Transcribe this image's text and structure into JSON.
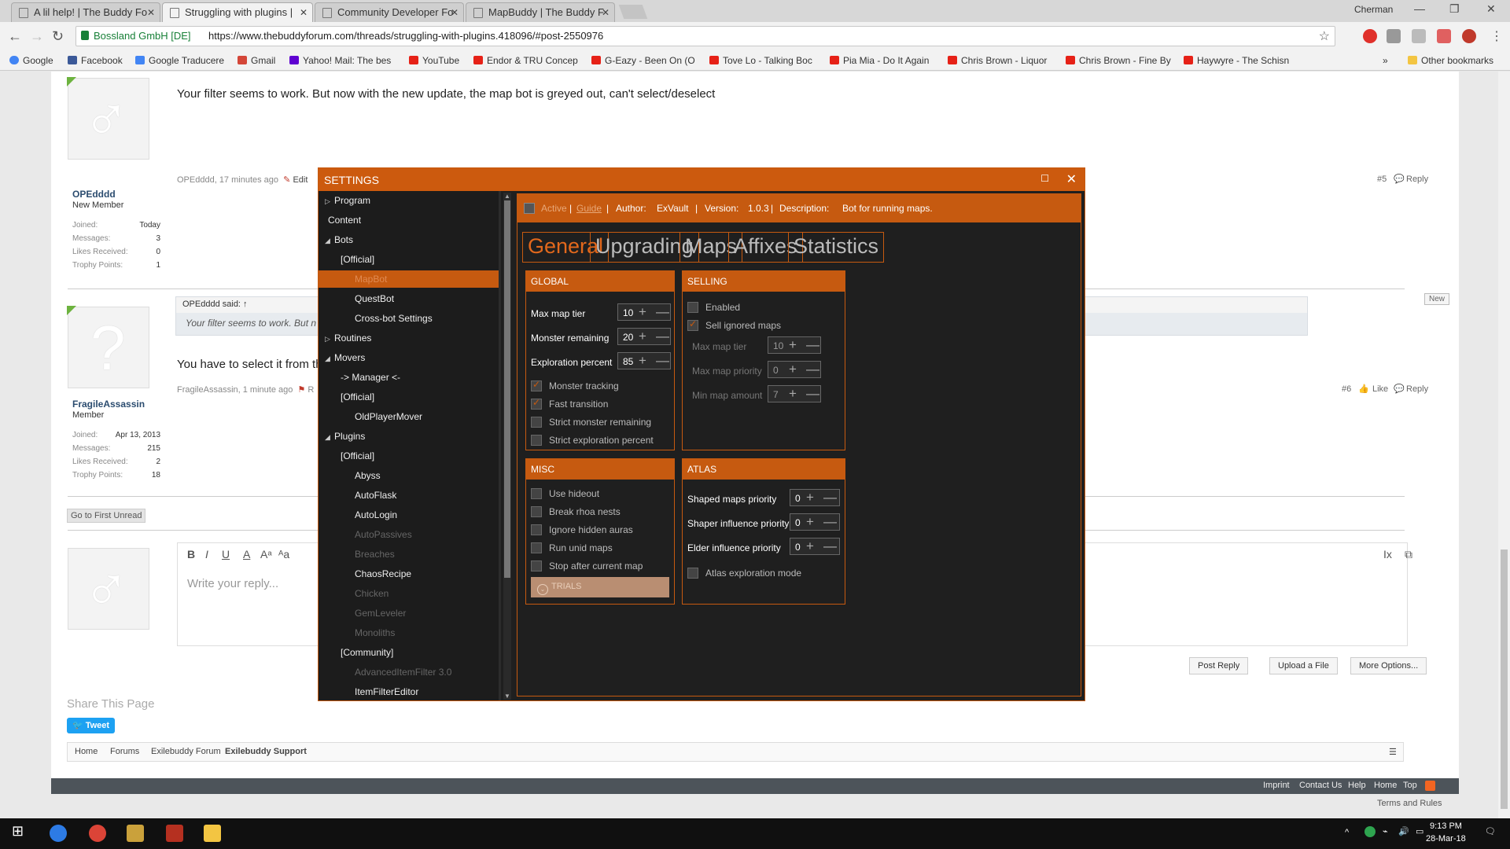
{
  "browser": {
    "tabs": [
      {
        "title": "A lil help! | The Buddy Fo"
      },
      {
        "title": "Struggling with plugins | "
      },
      {
        "title": "Community Developer Fo"
      },
      {
        "title": "MapBuddy | The Buddy F"
      }
    ],
    "user": "Cherman",
    "secure_label": "Bossland GmbH [DE]",
    "url": "https://www.thebuddyforum.com/threads/struggling-with-plugins.418096/#post-2550976",
    "bookmarks": [
      "Google",
      "Facebook",
      "Google Traducere",
      "Gmail",
      "Yahoo! Mail: The bes",
      "YouTube",
      "Endor & TRU Concep",
      "G-Eazy - Been On (O",
      "Tove Lo - Talking Boc",
      "Pia Mia - Do It Again",
      "Chris Brown - Liquor",
      "Chris Brown - Fine By",
      "Haywyre - The Schisn"
    ],
    "other_bookmarks": "Other bookmarks",
    "bookmark_more": "»"
  },
  "post1": {
    "text": "Your filter seems to work. But now with the new update, the map bot is greyed out, can't select/deselect",
    "username": "OPEdddd",
    "role": "New Member",
    "stats": [
      [
        "Joined:",
        "Today"
      ],
      [
        "Messages:",
        "3"
      ],
      [
        "Likes Received:",
        "0"
      ],
      [
        "Trophy Points:",
        "1"
      ]
    ],
    "meta": "OPEdddd, 17 minutes ago",
    "edit": "Edit",
    "num": "#5",
    "reply": "Reply"
  },
  "post2": {
    "quote_header": "OPEdddd said: ↑",
    "quote_body": "Your filter seems to work. But n",
    "text": "You have to select it from th",
    "username": "FragileAssassin",
    "role": "Member",
    "stats": [
      [
        "Joined:",
        "Apr 13, 2013"
      ],
      [
        "Messages:",
        "215"
      ],
      [
        "Likes Received:",
        "2"
      ],
      [
        "Trophy Points:",
        "18"
      ]
    ],
    "meta": "FragileAssassin, 1 minute ago",
    "meta_extra": "R",
    "num": "#6",
    "like": "Like",
    "reply": "Reply",
    "new_badge": "New"
  },
  "forum": {
    "go_first_unread": "Go to First Unread",
    "reply_placeholder": "Write your reply...",
    "post_reply": "Post Reply",
    "upload": "Upload a File",
    "more_options": "More Options...",
    "share_title": "Share This Page",
    "tweet": "Tweet",
    "breadcrumbs": [
      "Home",
      "Forums",
      "Exilebuddy Forum",
      "Exilebuddy Support"
    ],
    "footer_links": [
      "Imprint",
      "Contact Us",
      "Help",
      "Home",
      "Top"
    ],
    "terms": "Terms and Rules"
  },
  "settings": {
    "title": "SETTINGS",
    "tree": [
      {
        "label": "Program",
        "level": 0,
        "arrow": "▷",
        "dim": false
      },
      {
        "label": "Content",
        "level": 0,
        "arrow": "",
        "dim": false
      },
      {
        "label": "Bots",
        "level": 0,
        "arrow": "◢",
        "dim": false
      },
      {
        "label": "[Official]",
        "level": 1,
        "arrow": "",
        "dim": false
      },
      {
        "label": "MapBot",
        "level": 2,
        "arrow": "",
        "dim": false,
        "selected": true
      },
      {
        "label": "QuestBot",
        "level": 2,
        "arrow": "",
        "dim": false
      },
      {
        "label": "Cross-bot Settings",
        "level": 2,
        "arrow": "",
        "dim": false
      },
      {
        "label": "Routines",
        "level": 0,
        "arrow": "▷",
        "dim": false
      },
      {
        "label": "Movers",
        "level": 0,
        "arrow": "◢",
        "dim": false
      },
      {
        "label": "-> Manager <-",
        "level": 1,
        "arrow": "",
        "dim": false
      },
      {
        "label": "[Official]",
        "level": 1,
        "arrow": "",
        "dim": false
      },
      {
        "label": "OldPlayerMover",
        "level": 2,
        "arrow": "",
        "dim": false
      },
      {
        "label": "Plugins",
        "level": 0,
        "arrow": "◢",
        "dim": false
      },
      {
        "label": "[Official]",
        "level": 1,
        "arrow": "",
        "dim": false
      },
      {
        "label": "Abyss",
        "level": 2,
        "arrow": "",
        "dim": false
      },
      {
        "label": "AutoFlask",
        "level": 2,
        "arrow": "",
        "dim": false
      },
      {
        "label": "AutoLogin",
        "level": 2,
        "arrow": "",
        "dim": false
      },
      {
        "label": "AutoPassives",
        "level": 2,
        "arrow": "",
        "dim": true
      },
      {
        "label": "Breaches",
        "level": 2,
        "arrow": "",
        "dim": true
      },
      {
        "label": "ChaosRecipe",
        "level": 2,
        "arrow": "",
        "dim": false
      },
      {
        "label": "Chicken",
        "level": 2,
        "arrow": "",
        "dim": true
      },
      {
        "label": "GemLeveler",
        "level": 2,
        "arrow": "",
        "dim": true
      },
      {
        "label": "Monoliths",
        "level": 2,
        "arrow": "",
        "dim": true
      },
      {
        "label": "[Community]",
        "level": 1,
        "arrow": "",
        "dim": false
      },
      {
        "label": "AdvancedItemFilter 3.0",
        "level": 2,
        "arrow": "",
        "dim": true
      },
      {
        "label": "ItemFilterEditor",
        "level": 2,
        "arrow": "",
        "dim": false
      }
    ],
    "info": {
      "active": "Active",
      "guide": "Guide",
      "author_label": "Author:",
      "author": "ExVault",
      "version_label": "Version:",
      "version": "1.0.3",
      "desc_label": "Description:",
      "desc": "Bot for running maps.",
      "sep": "|"
    },
    "tabs": [
      "General",
      "Upgrading",
      "Maps",
      "Affixes",
      "Statistics"
    ],
    "global": {
      "title": "GLOBAL",
      "fields": [
        {
          "label": "Max map tier",
          "value": "10"
        },
        {
          "label": "Monster remaining",
          "value": "20"
        },
        {
          "label": "Exploration percent",
          "value": "85"
        }
      ],
      "checks": [
        {
          "label": "Monster tracking",
          "on": true
        },
        {
          "label": "Fast transition",
          "on": true
        },
        {
          "label": "Strict monster remaining",
          "on": false
        },
        {
          "label": "Strict exploration percent",
          "on": false
        }
      ]
    },
    "selling": {
      "title": "SELLING",
      "checks": [
        {
          "label": "Enabled",
          "on": false
        },
        {
          "label": "Sell ignored maps",
          "on": true
        }
      ],
      "fields": [
        {
          "label": "Max map tier",
          "value": "10"
        },
        {
          "label": "Max map priority",
          "value": "0"
        },
        {
          "label": "Min map amount",
          "value": "7"
        }
      ]
    },
    "misc": {
      "title": "MISC",
      "checks": [
        {
          "label": "Use hideout",
          "on": false
        },
        {
          "label": "Break rhoa nests",
          "on": false
        },
        {
          "label": "Ignore hidden auras",
          "on": false
        },
        {
          "label": "Run unid maps",
          "on": false
        },
        {
          "label": "Stop after current map",
          "on": false
        }
      ],
      "trials": "TRIALS"
    },
    "atlas": {
      "title": "ATLAS",
      "fields": [
        {
          "label": "Shaped maps priority",
          "value": "0"
        },
        {
          "label": "Shaper influence priority",
          "value": "0"
        },
        {
          "label": "Elder influence priority",
          "value": "0"
        }
      ],
      "check": {
        "label": "Atlas exploration mode",
        "on": false
      }
    }
  },
  "taskbar": {
    "time": "9:13 PM",
    "date": "28-Mar-18"
  }
}
